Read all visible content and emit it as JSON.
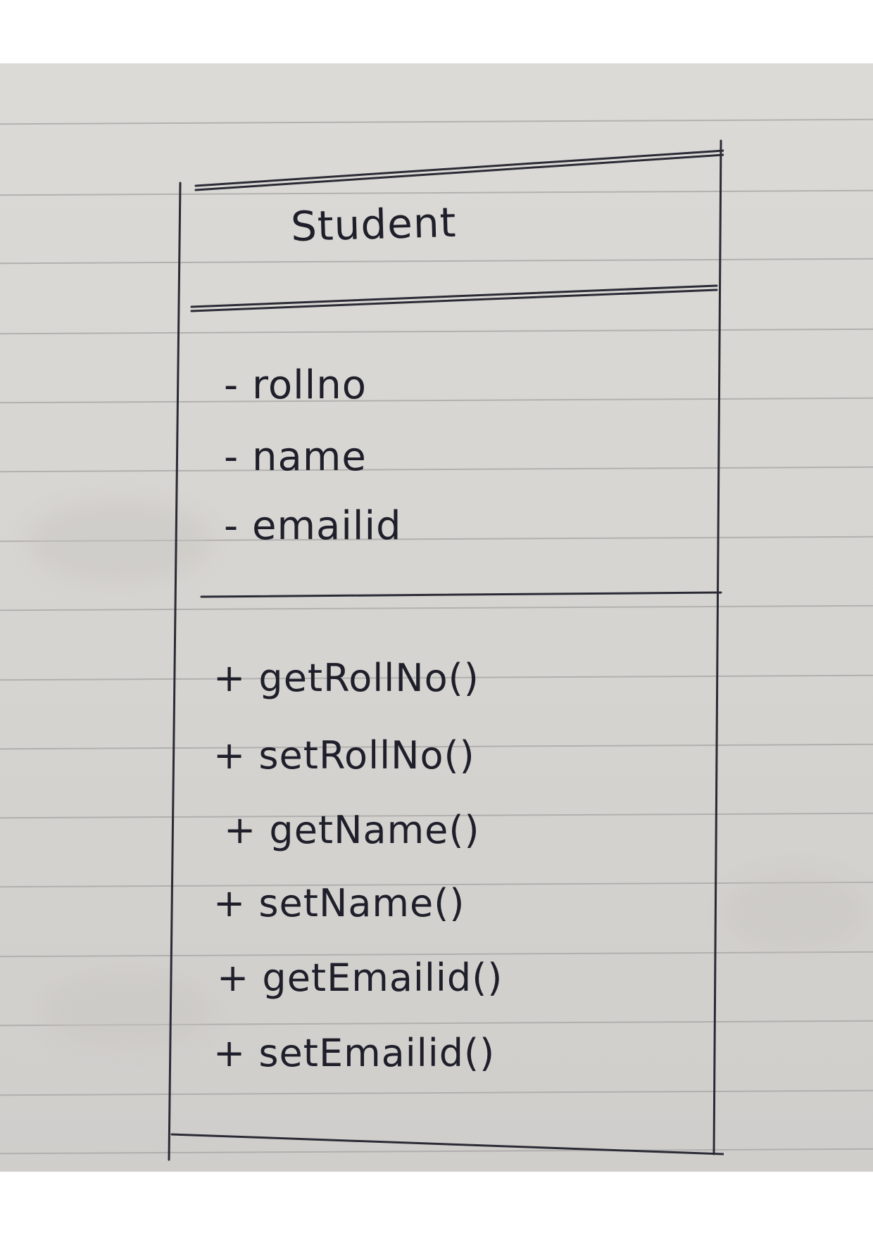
{
  "uml_class": {
    "name": "Student",
    "attributes": [
      {
        "visibility": "-",
        "name": "rollno"
      },
      {
        "visibility": "-",
        "name": "name"
      },
      {
        "visibility": "-",
        "name": "emailid"
      }
    ],
    "methods": [
      {
        "visibility": "+",
        "name": "getRollNo()"
      },
      {
        "visibility": "+",
        "name": "setRollNo()"
      },
      {
        "visibility": "+",
        "name": "getName()"
      },
      {
        "visibility": "+",
        "name": "setName()"
      },
      {
        "visibility": "+",
        "name": "getEmailid()"
      },
      {
        "visibility": "+",
        "name": "setEmailid()"
      }
    ]
  },
  "colors": {
    "ink": "#1e1f2a",
    "paper": "#d8d6d2",
    "ruled_line": "#a9a8a6"
  }
}
